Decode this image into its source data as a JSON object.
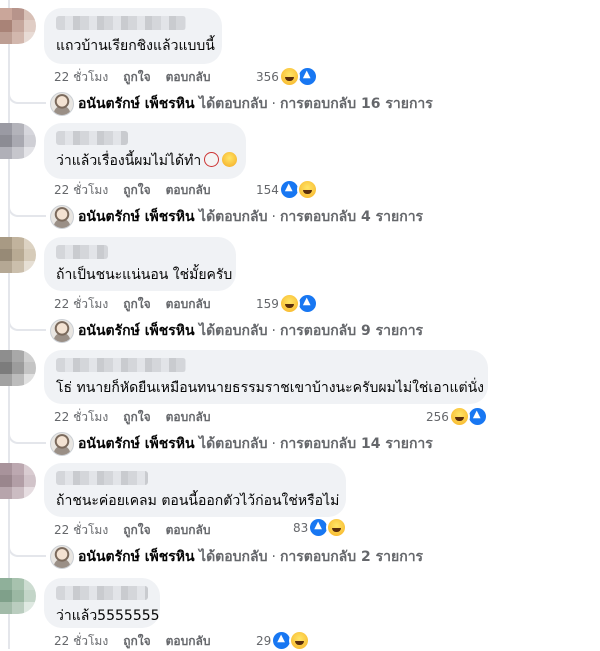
{
  "labels": {
    "like": "ถูกใจ",
    "reply": "ตอบกลับ",
    "replied": "ได้ตอบกลับ",
    "sep": "·"
  },
  "replier": "อนันตรักษ์ เพ็ชรหิน",
  "comments": [
    {
      "text": "แถวบ้านเรียกชิงแล้วแบบนี้",
      "emoji": [],
      "time": "22 ชั่วโมง",
      "reaction_count": "356",
      "reactions": [
        "haha",
        "like"
      ],
      "reply_count": "การตอบกลับ 16 รายการ"
    },
    {
      "text": "ว่าแล้วเรื่องนี้ผมไม่ได้ทำ",
      "emoji": [
        "clown",
        "rofl"
      ],
      "time": "22 ชั่วโมง",
      "reaction_count": "154",
      "reactions": [
        "like",
        "haha"
      ],
      "reply_count": "การตอบกลับ 4 รายการ"
    },
    {
      "text": "ถ้าเป็นชนะแน่นอน ใช่มั้ยครับ",
      "emoji": [],
      "time": "22 ชั่วโมง",
      "reaction_count": "159",
      "reactions": [
        "haha",
        "like"
      ],
      "reply_count": "การตอบกลับ 9 รายการ"
    },
    {
      "text": "โธ่ ทนายก็หัดยืนเหมือนทนายธรรมราชเขาบ้างนะครับผมไม่ใช่เอาแต่นั่ง",
      "emoji": [],
      "time": "22 ชั่วโมง",
      "reaction_count": "256",
      "reactions": [
        "haha",
        "like"
      ],
      "reply_count": "การตอบกลับ 14 รายการ"
    },
    {
      "text": "ถ้าชนะค่อยเคลม ตอนนี้ออกตัวไว้ก่อนใช่หรือไม่",
      "emoji": [],
      "time": "22 ชั่วโมง",
      "reaction_count": "83",
      "reactions": [
        "like",
        "haha"
      ],
      "reply_count": "การตอบกลับ 2 รายการ"
    },
    {
      "text": "ว่าแล้ว5555555",
      "emoji": [],
      "time": "22 ชั่วโมง",
      "reaction_count": "29",
      "reactions": [
        "like",
        "haha"
      ],
      "reply_count": ""
    }
  ]
}
